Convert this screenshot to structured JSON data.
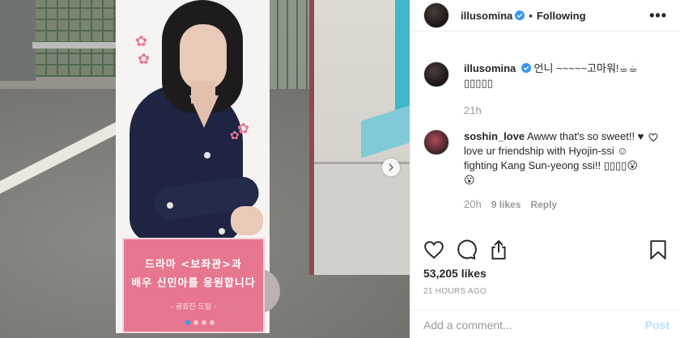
{
  "post": {
    "banner": {
      "line1": "드라마 <보좌관>과",
      "line2": "배우 신민아를 응원합니다",
      "line3": "- 공효진 드림 -"
    },
    "carousel": {
      "slides": 4,
      "active_index": 0
    }
  },
  "header": {
    "username": "illusomina",
    "separator": "•",
    "follow_label": "Following",
    "more_label": "•••"
  },
  "caption": {
    "username": "illusomina",
    "text": "언니 ~~~~~고마워!☕☕ ▯▯▯▯▯",
    "time": "21h"
  },
  "comments": [
    {
      "username": "soshin_love",
      "text": "Awww that's so sweet!! ♥ love ur friendship with Hyojin-ssi ☺ fighting Kang Sun-yeong ssi!! ▯▯▯▯😮😮",
      "time": "20h",
      "likes": "9 likes",
      "reply": "Reply"
    }
  ],
  "engagement": {
    "likes": "53,205 likes",
    "time_ago": "21 HOURS AGO"
  },
  "comment_box": {
    "placeholder": "Add a comment...",
    "post_label": "Post"
  },
  "colors": {
    "verified": "#3897f0",
    "link_blue": "#3897f0",
    "post_disabled": "#b2dffc",
    "banner_pink": "#e7768f"
  },
  "icons": [
    "verified-badge-icon",
    "more-options-icon",
    "heart-icon",
    "comment-icon",
    "share-icon",
    "bookmark-icon",
    "comment-heart-icon",
    "chevron-right-icon"
  ]
}
